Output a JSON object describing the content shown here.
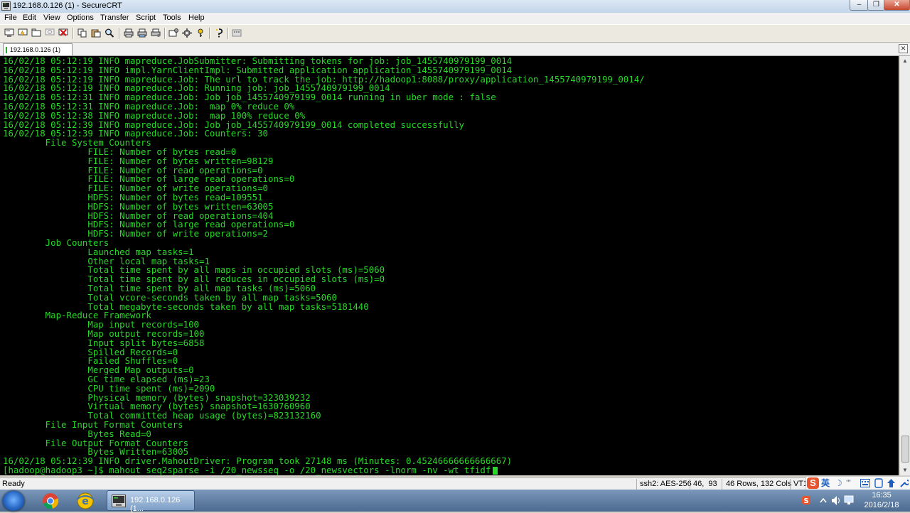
{
  "window": {
    "title": "192.168.0.126 (1) - SecureCRT",
    "buttons": [
      "minimize",
      "maximize",
      "close"
    ]
  },
  "menu": [
    "File",
    "Edit",
    "View",
    "Options",
    "Transfer",
    "Script",
    "Tools",
    "Help"
  ],
  "toolbar_icons": [
    "connect-icon",
    "quick-connect-icon",
    "connect-in-tab-icon",
    "reconnect-icon",
    "disconnect-icon",
    "copy-icon",
    "paste-icon",
    "find-icon",
    "print-icon",
    "print-selection-icon",
    "print-setup-icon",
    "session-options-icon",
    "global-options-icon",
    "key-icon",
    "help-icon",
    "keymap-icon"
  ],
  "tab": {
    "label": "192.168.0.126 (1)"
  },
  "terminal": {
    "lines": [
      "16/02/18 05:12:19 INFO mapreduce.JobSubmitter: Submitting tokens for job: job_1455740979199_0014",
      "16/02/18 05:12:19 INFO impl.YarnClientImpl: Submitted application application_1455740979199_0014",
      "16/02/18 05:12:19 INFO mapreduce.Job: The url to track the job: http://hadoop1:8088/proxy/application_1455740979199_0014/",
      "16/02/18 05:12:19 INFO mapreduce.Job: Running job: job_1455740979199_0014",
      "16/02/18 05:12:31 INFO mapreduce.Job: Job job_1455740979199_0014 running in uber mode : false",
      "16/02/18 05:12:31 INFO mapreduce.Job:  map 0% reduce 0%",
      "16/02/18 05:12:38 INFO mapreduce.Job:  map 100% reduce 0%",
      "16/02/18 05:12:39 INFO mapreduce.Job: Job job_1455740979199_0014 completed successfully",
      "16/02/18 05:12:39 INFO mapreduce.Job: Counters: 30",
      "        File System Counters",
      "                FILE: Number of bytes read=0",
      "                FILE: Number of bytes written=98129",
      "                FILE: Number of read operations=0",
      "                FILE: Number of large read operations=0",
      "                FILE: Number of write operations=0",
      "                HDFS: Number of bytes read=109551",
      "                HDFS: Number of bytes written=63005",
      "                HDFS: Number of read operations=404",
      "                HDFS: Number of large read operations=0",
      "                HDFS: Number of write operations=2",
      "        Job Counters",
      "                Launched map tasks=1",
      "                Other local map tasks=1",
      "                Total time spent by all maps in occupied slots (ms)=5060",
      "                Total time spent by all reduces in occupied slots (ms)=0",
      "                Total time spent by all map tasks (ms)=5060",
      "                Total vcore-seconds taken by all map tasks=5060",
      "                Total megabyte-seconds taken by all map tasks=5181440",
      "        Map-Reduce Framework",
      "                Map input records=100",
      "                Map output records=100",
      "                Input split bytes=6858",
      "                Spilled Records=0",
      "                Failed Shuffles=0",
      "                Merged Map outputs=0",
      "                GC time elapsed (ms)=23",
      "                CPU time spent (ms)=2090",
      "                Physical memory (bytes) snapshot=323039232",
      "                Virtual memory (bytes) snapshot=1630760960",
      "                Total committed heap usage (bytes)=823132160",
      "        File Input Format Counters",
      "                Bytes Read=0",
      "        File Output Format Counters",
      "                Bytes Written=63005",
      "16/02/18 05:12:39 INFO driver.MahoutDriver: Program took 27148 ms (Minutes: 0.45246666666666667)",
      "[hadoop@hadoop3 ~]$ mahout seq2sparse -i /20_newsseq -o /20_newsvectors -lnorm -nv -wt tfidf"
    ],
    "text_color": "#28d728",
    "background": "#000000"
  },
  "status": {
    "ready": "Ready",
    "cipher": "ssh2: AES-256",
    "cursor_pos": "46,  93",
    "size": "46 Rows, 132 Cols",
    "emulation": "VT1"
  },
  "ime": {
    "lang": "英"
  },
  "taskbar": {
    "active_task": "192.168.0.126 (1...",
    "time": "16:35",
    "date": "2016/2/18"
  }
}
